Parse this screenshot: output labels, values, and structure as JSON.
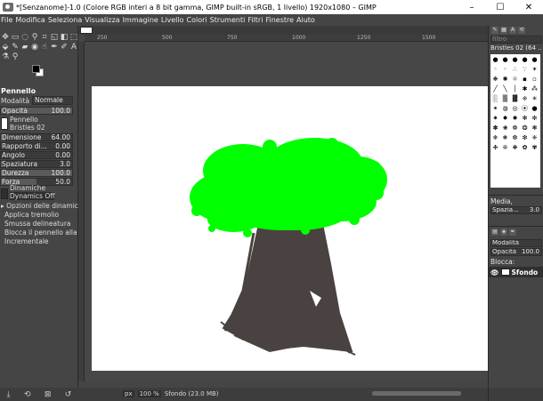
{
  "window": {
    "title": "*[Senzanome]-1.0 (Colore RGB interi a 8 bit gamma, GIMP built-in sRGB, 1 livello) 1920x1080 – GIMP",
    "minimize": "–",
    "maximize": "☐",
    "close": "✕"
  },
  "menu": [
    "File",
    "Modifica",
    "Seleziona",
    "Visualizza",
    "Immagine",
    "Livello",
    "Colori",
    "Strumenti",
    "Filtri",
    "Finestre",
    "Aiuto"
  ],
  "tool_options": {
    "title": "Pennello",
    "mode_label": "Modalità",
    "mode_value": "Normale",
    "opacity_label": "Opacità",
    "opacity_value": "100.0",
    "brush_label": "Pennello",
    "brush_value": "Bristles 02",
    "size_label": "Dimensione",
    "size_value": "64.00",
    "aspect_label": "Rapporto di...",
    "aspect_value": "0.00",
    "angle_label": "Angolo",
    "angle_value": "0.00",
    "spacing_label": "Spaziatura",
    "spacing_value": "3.0",
    "hardness_label": "Durezza",
    "hardness_value": "100.0",
    "force_label": "Forza",
    "force_value": "50.0",
    "dynamics_label": "Dinamiche",
    "dynamics_value": "Dynamics Off",
    "dynamics_options": "Opzioni delle dinamiche",
    "jitter": "Applica tremolio",
    "smooth": "Smussa delineatura",
    "lock_brush": "Blocca il pennello alla vis",
    "incremental": "Incrementale"
  },
  "rulers": {
    "h_ticks": [
      "250",
      "500",
      "750",
      "1000",
      "1250",
      "1500"
    ]
  },
  "status": {
    "unit": "px",
    "zoom": "100 %",
    "layer_info": "Sfondo (23.0 MB)"
  },
  "dock": {
    "filter_placeholder": "filtro",
    "brush_name": "Bristles 02 (64 ...",
    "mode_label": "Media,",
    "spacing_label": "Spazia...",
    "spacing_value": "3.0",
    "layers_tab": "Modalità",
    "opacity_label": "Opacità",
    "opacity_value": "100.0",
    "lock_label": "Blocca:",
    "layer_name": "Sfondo"
  },
  "colors": {
    "foliage": "#00ff00",
    "trunk": "#4a4240",
    "ui_bg": "#454545"
  }
}
